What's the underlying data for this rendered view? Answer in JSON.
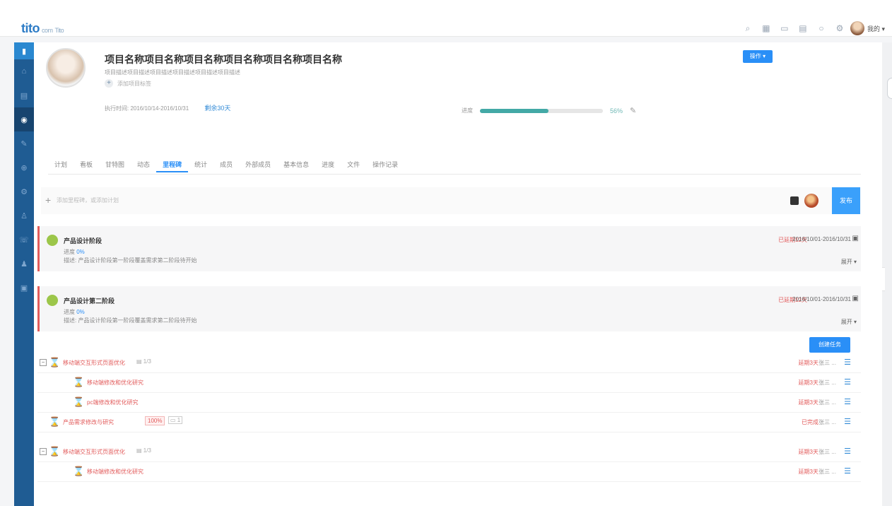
{
  "app": {
    "logo_primary": "tito",
    "logo_secondary": "com",
    "logo_sub": "Tito",
    "user_name": "我的 ▾",
    "top_icons": [
      "search-icon",
      "grid-icon",
      "calendar-icon",
      "doc-icon",
      "bell-icon",
      "settings-icon"
    ]
  },
  "sidebar": {
    "items": [
      "▮",
      "⌂",
      "▤",
      "◉",
      "✎",
      "⊕",
      "⚙",
      "♙",
      "☏",
      "♟",
      "▣"
    ]
  },
  "project": {
    "title": "项目名称项目名称项目名称项目名称项目名称项目名称",
    "description": "项目描述项目描述项目描述项目描述项目描述项目描述",
    "add_label": "添加项目标签",
    "date_range": "执行时间: 2016/10/14-2016/10/31",
    "days": "剩余30天",
    "operate_label": "操作 ▾",
    "progress_label": "进度",
    "progress_value": 0.56,
    "progress_text": "56%"
  },
  "tabs": [
    "计划",
    "看板",
    "甘特图",
    "动态",
    "里程碑",
    "统计",
    "成员",
    "外部成员",
    "基本信息",
    "进度",
    "文件",
    "操作记录"
  ],
  "add_bar": {
    "placeholder": "添加里程碑，或添加计划",
    "publish_label": "发布"
  },
  "phases": [
    {
      "name": "产品设计阶段",
      "pct_label": "进度",
      "pct_value": "0%",
      "desc": "描述: 产品设计阶段第一阶段覆盖需求第二阶段待开始",
      "overdue": "已延期12天",
      "dates": "2016/10/01-2016/10/31",
      "expand": "展开 ▾"
    },
    {
      "name": "产品设计第二阶段",
      "pct_label": "进度",
      "pct_value": "0%",
      "desc": "描述: 产品设计阶段第一阶段覆盖需求第二阶段待开始",
      "overdue": "已延期12天",
      "dates": "2016/10/01-2016/10/31",
      "expand": "展开 ▾"
    }
  ],
  "tasks": {
    "new_task_label": "创建任务",
    "rows": [
      {
        "name": "移动端交互形式页面优化",
        "sub_count": "1/3",
        "status": "延期3天",
        "owner": "张三 ...",
        "level": 0,
        "toggle": "−"
      },
      {
        "name": "移动端修改和优化研究",
        "status": "延期3天",
        "owner": "张三 ...",
        "level": 1
      },
      {
        "name": "pc端修改和优化研究",
        "status": "延期3天",
        "owner": "张三 ...",
        "level": 1
      },
      {
        "name": "产品需求修改与研究",
        "badge": "100%",
        "doc": "1",
        "status": "已完成",
        "owner": "张三 ...",
        "level": 0
      },
      {
        "name": "移动端交互形式页面优化",
        "sub_count": "1/3",
        "status": "延期3天",
        "owner": "张三 ...",
        "level": 0,
        "toggle": "−"
      },
      {
        "name": "移动端修改和优化研究",
        "status": "延期3天",
        "owner": "张三 ...",
        "level": 1
      }
    ]
  }
}
